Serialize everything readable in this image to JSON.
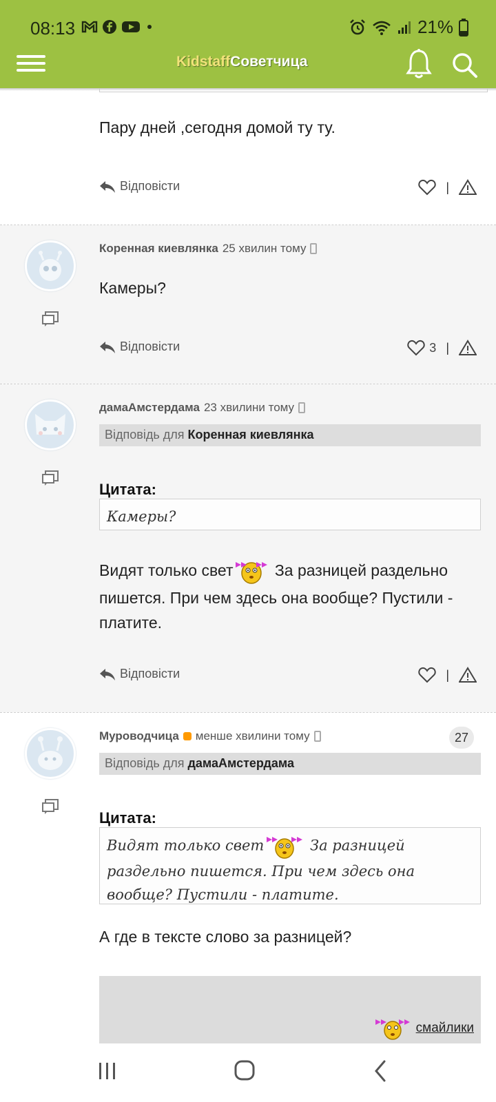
{
  "status_bar": {
    "time": "08:13",
    "battery": "21%"
  },
  "app_bar": {
    "logo_part1": "Kidstaff",
    "logo_part2": "Советчица"
  },
  "colors": {
    "brand_green": "#9dc142",
    "status_orange": "#ff9a00"
  },
  "top_comment": {
    "text": "Пару дней ,сегодня домой ту ту.",
    "reply_label": "Відповісти"
  },
  "posts": [
    {
      "author": "Коренная киевлянка",
      "time": "25 хвилин тому",
      "text": "Камеры?",
      "reply_label": "Відповісти",
      "likes": "3"
    },
    {
      "author": "дамаАмстердама",
      "time": "23 хвилини тому",
      "reply_to_prefix": "Відповідь для",
      "reply_to_name": "Коренная киевлянка",
      "quote_label": "Цитата:",
      "quote_text": "Камеры?",
      "text_part1": "Видят только свет",
      "text_part2": " За разницей раздельно пишется. При чем здесь она вообще? Пустили - платите.",
      "reply_label": "Відповісти"
    },
    {
      "author": "Муроводчица",
      "time": "менше хвилини тому",
      "count": "27",
      "reply_to_prefix": "Відповідь для",
      "reply_to_name": "дамаАмстердама",
      "quote_label": "Цитата:",
      "quote_part1": "Видят только свет",
      "quote_part2": " За разницей раздельно пишется. При чем здесь она вообще? Пустили - платите.",
      "text": "А где в тексте слово за разницей?"
    }
  ],
  "editor": {
    "smileys_link": "смайлики"
  }
}
